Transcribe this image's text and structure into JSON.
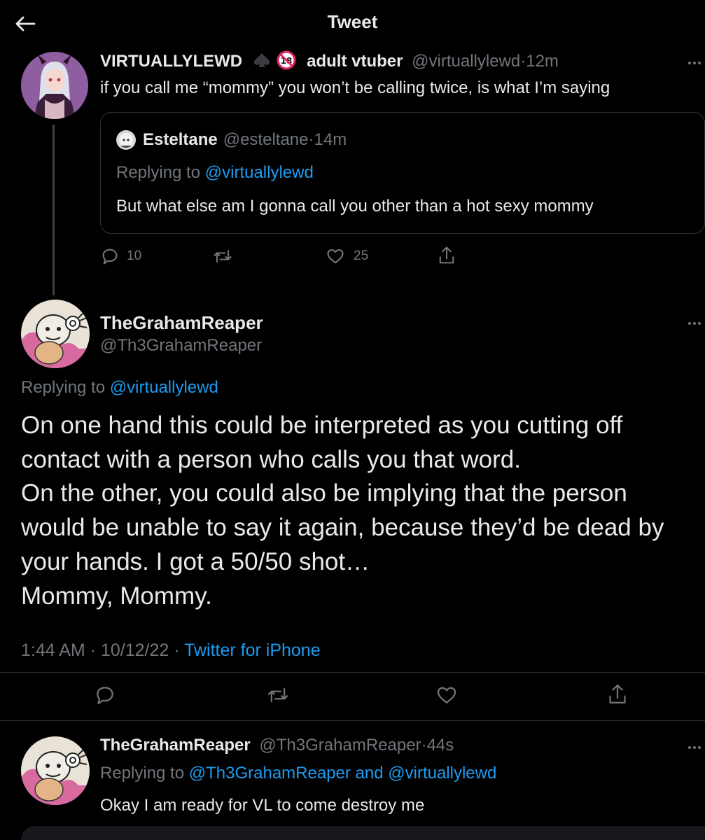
{
  "header": {
    "title": "Tweet"
  },
  "tweet1": {
    "display_name": "VIRTUALLYLEWD",
    "bio_tag": "adult vtuber",
    "handle": "@virtuallylewd",
    "separator": "·",
    "time": "12m",
    "text": "if you call me “mommy” you won’t be calling twice, is what I’m saying",
    "quote": {
      "display_name": "Esteltane",
      "handle": "@esteltane",
      "separator": "·",
      "time": "14m",
      "replying_prefix": "Replying to",
      "replying_to": "@virtuallylewd",
      "text": "But what else am I gonna call you other than a hot sexy mommy"
    },
    "actions": {
      "replies": "10",
      "likes": "25"
    }
  },
  "main_tweet": {
    "display_name": "TheGrahamReaper",
    "handle": "@Th3GrahamReaper",
    "replying_prefix": "Replying to",
    "replying_to": "@virtuallylewd",
    "lines": [
      "On one hand this could be interpreted as you cutting off",
      "contact with a person who calls you that word.",
      "On the other, you could also be implying that the person",
      "would be unable to say it again, because they’d be dead by",
      "your hands. I got a 50/50 shot…",
      "Mommy, Mommy."
    ],
    "time": "1:44 AM",
    "date": "10/12/22",
    "separator": "·",
    "source": "Twitter for iPhone"
  },
  "reply": {
    "display_name": "TheGrahamReaper",
    "handle": "@Th3GrahamReaper",
    "separator": "·",
    "time": "44s",
    "replying_prefix": "Replying to",
    "replying_to": "@Th3GrahamReaper and @virtuallylewd",
    "text": "Okay I am ready for VL to come destroy me"
  },
  "colors": {
    "background": "#000000",
    "text": "#e7e9ea",
    "muted": "#71767b",
    "link": "#1d9bf0",
    "border": "#2f3336"
  },
  "icons": [
    "back-arrow-icon",
    "spade-icon",
    "no-under-18-icon",
    "more-icon",
    "reply-icon",
    "retweet-icon",
    "like-icon",
    "share-icon"
  ]
}
